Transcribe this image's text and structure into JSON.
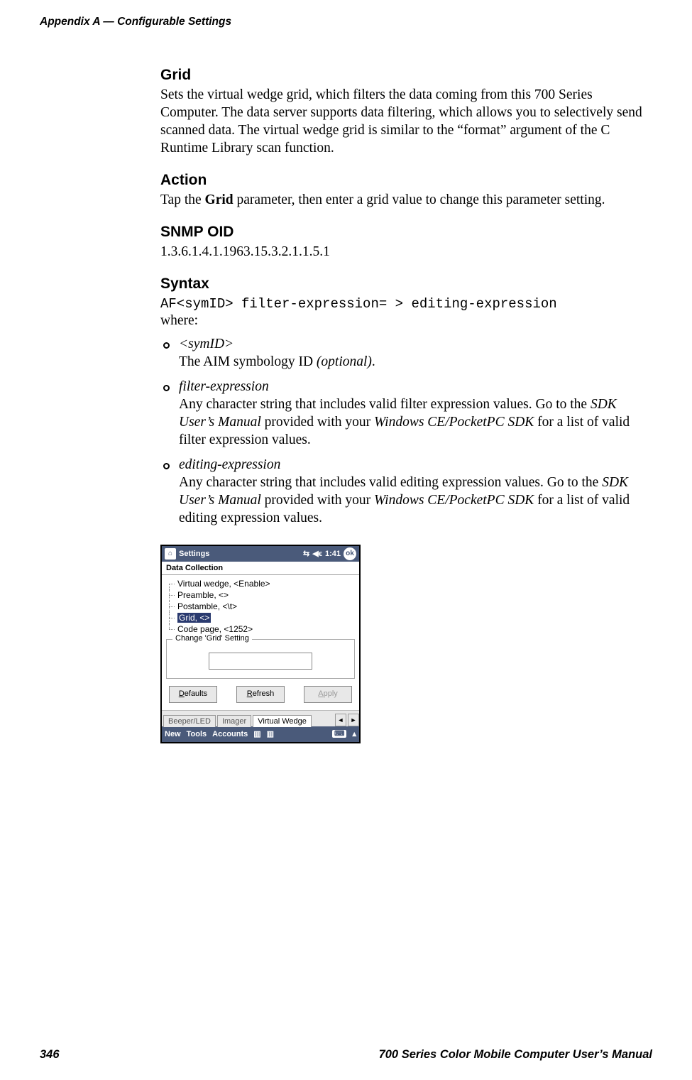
{
  "running_head": "Appendix  A   —   Configurable Settings",
  "sections": {
    "grid": {
      "heading": "Grid",
      "body": "Sets the virtual wedge grid, which filters the data coming from this 700 Series Computer. The data server supports data filtering, which allows you to selectively send scanned data. The virtual wedge grid is similar to the “format” argument of the C Runtime Library scan function."
    },
    "action": {
      "heading": "Action",
      "pre": "Tap the ",
      "bold": "Grid",
      "post": " parameter, then enter a grid value to change this parameter setting."
    },
    "snmp": {
      "heading": "SNMP OID",
      "value": "1.3.6.1.4.1.1963.15.3.2.1.1.5.1"
    },
    "syntax": {
      "heading": "Syntax",
      "code": "AF<symID> filter-expression= > editing-expression",
      "where": "where:"
    }
  },
  "bullets": [
    {
      "term": "<symID>",
      "body_pre": "The AIM symbology ID ",
      "body_ital": "(optional)",
      "body_post": "."
    },
    {
      "term": "filter-expression",
      "body_pre": "Any character string that includes valid filter expression values. Go to the ",
      "body_ital1": "SDK User’s Manual",
      "body_mid": " provided with your ",
      "body_ital2": "Windows CE/PocketPC SDK",
      "body_post": " for a list of valid filter expression values."
    },
    {
      "term": "editing-expression",
      "body_pre": "Any character string that includes valid editing expression values. Go to the ",
      "body_ital1": "SDK User’s Manual",
      "body_mid": " provided with your ",
      "body_ital2": "Windows CE/PocketPC SDK",
      "body_post": " for a list of valid editing expression values."
    }
  ],
  "ppc": {
    "title": "Settings",
    "time": "1:41",
    "ok": "ok",
    "app_title": "Data Collection",
    "tree": {
      "r1": "Virtual wedge, <Enable>",
      "r2": "Preamble, <>",
      "r3": "Postamble, <\\t>",
      "r4": "Grid, <>",
      "r5": "Code page, <1252>"
    },
    "group_legend": "Change 'Grid' Setting",
    "input_value": "",
    "buttons": {
      "defaults_u": "D",
      "defaults_rest": "efaults",
      "refresh_u": "R",
      "refresh_rest": "efresh",
      "apply_u": "A",
      "apply_rest": "pply"
    },
    "tabs": {
      "t1": "Beeper/LED",
      "t2": "Imager",
      "t3": "Virtual Wedge"
    },
    "bottom": {
      "m1": "New",
      "m2": "Tools",
      "m3": "Accounts"
    }
  },
  "footer": {
    "page": "346",
    "title": "700 Series Color Mobile Computer User’s Manual"
  }
}
